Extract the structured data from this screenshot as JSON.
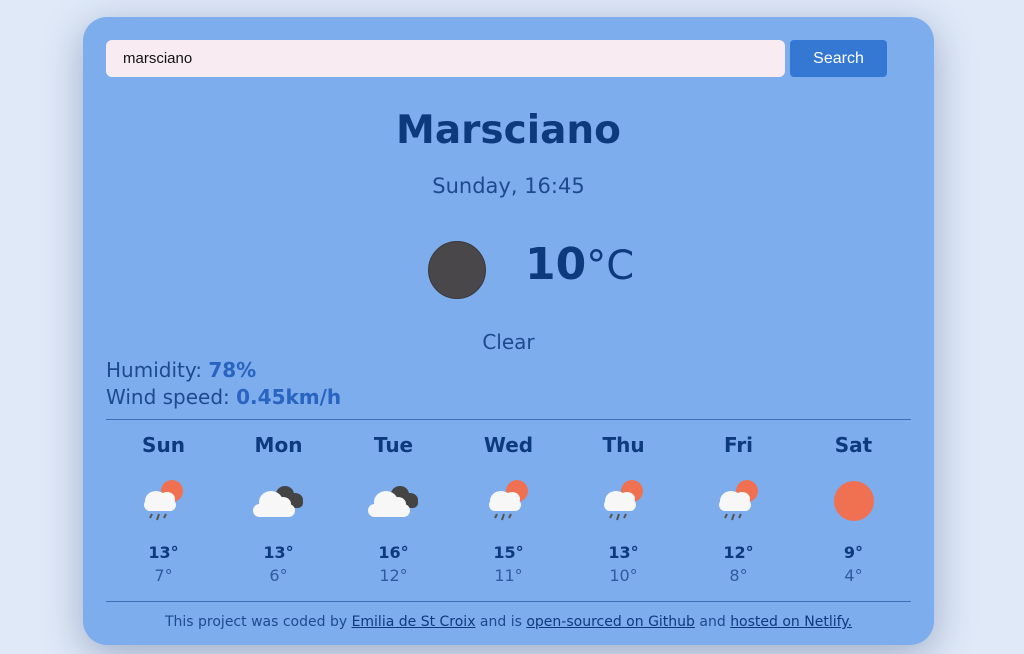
{
  "search": {
    "value": "marsciano",
    "button_label": "Search"
  },
  "current": {
    "city": "Marsciano",
    "datetime": "Sunday, 16:45",
    "icon": "dark-circle-icon",
    "temperature": "10",
    "unit": "°C",
    "description": "Clear",
    "humidity_label": "Humidity: ",
    "humidity_value": "78%",
    "wind_label": "Wind speed: ",
    "wind_value": "0.45km/h"
  },
  "forecast": [
    {
      "day": "Sun",
      "icon": "sun-cloud-rain-icon",
      "max": "13°",
      "min": "7°"
    },
    {
      "day": "Mon",
      "icon": "dark-cloud-icon",
      "max": "13°",
      "min": "6°"
    },
    {
      "day": "Tue",
      "icon": "dark-cloud-icon",
      "max": "16°",
      "min": "12°"
    },
    {
      "day": "Wed",
      "icon": "sun-cloud-rain-icon",
      "max": "15°",
      "min": "11°"
    },
    {
      "day": "Thu",
      "icon": "sun-cloud-rain-icon",
      "max": "13°",
      "min": "10°"
    },
    {
      "day": "Fri",
      "icon": "sun-cloud-rain-icon",
      "max": "12°",
      "min": "8°"
    },
    {
      "day": "Sat",
      "icon": "sun-icon",
      "max": "9°",
      "min": "4°"
    }
  ],
  "footer": {
    "text1": "This project was coded by ",
    "link1": "Emilia de St Croix",
    "text2": " and is ",
    "link2": "open-sourced on Github",
    "text3": " and ",
    "link3": "hosted on Netlify."
  },
  "colors": {
    "background": "#dfe9f8",
    "card": "#7eaded",
    "accent": "#3478d4",
    "heading": "#0d3a7c",
    "sun": "#ef7151"
  }
}
